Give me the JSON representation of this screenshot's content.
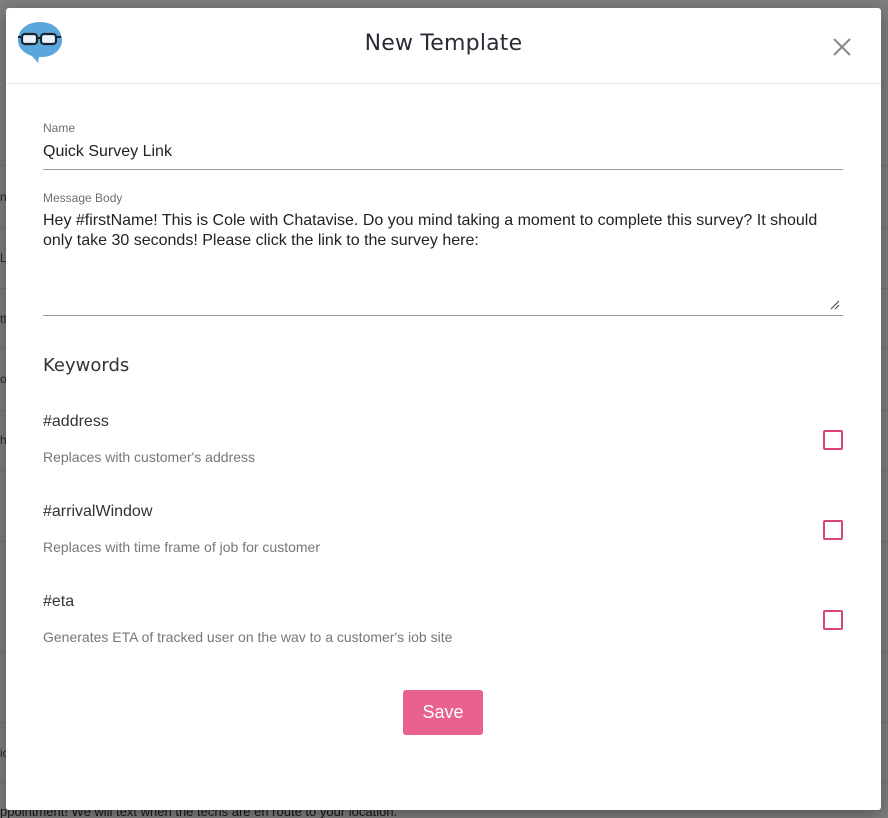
{
  "background": {
    "fragments": [
      "ni",
      "La",
      "tt",
      "oi",
      "h",
      "ic"
    ],
    "bottom_text": "ppointment! We will text when the techs are en route to your location."
  },
  "modal": {
    "title": "New Template",
    "logo_icon": "chat-bubble-glasses-icon",
    "close_icon": "close-icon"
  },
  "form": {
    "name_label": "Name",
    "name_value": "Quick Survey Link",
    "message_label": "Message Body",
    "message_value": "Hey #firstName! This is Cole with Chatavise. Do you mind taking a moment to complete this survey? It should only take 30 seconds! Please click the link to the survey here:"
  },
  "keywords": {
    "title": "Keywords",
    "items": [
      {
        "name": "#address",
        "description": "Replaces with customer's address",
        "checked": false
      },
      {
        "name": "#arrivalWindow",
        "description": "Replaces with time frame of job for customer",
        "checked": false
      },
      {
        "name": "#eta",
        "description": "Generates ETA of tracked user on the way to a customer's job site",
        "checked": false
      }
    ]
  },
  "actions": {
    "save_label": "Save"
  },
  "colors": {
    "accent": "#e9628f",
    "checkbox_border": "#d9447a",
    "logo_blue": "#5aa7dc"
  }
}
